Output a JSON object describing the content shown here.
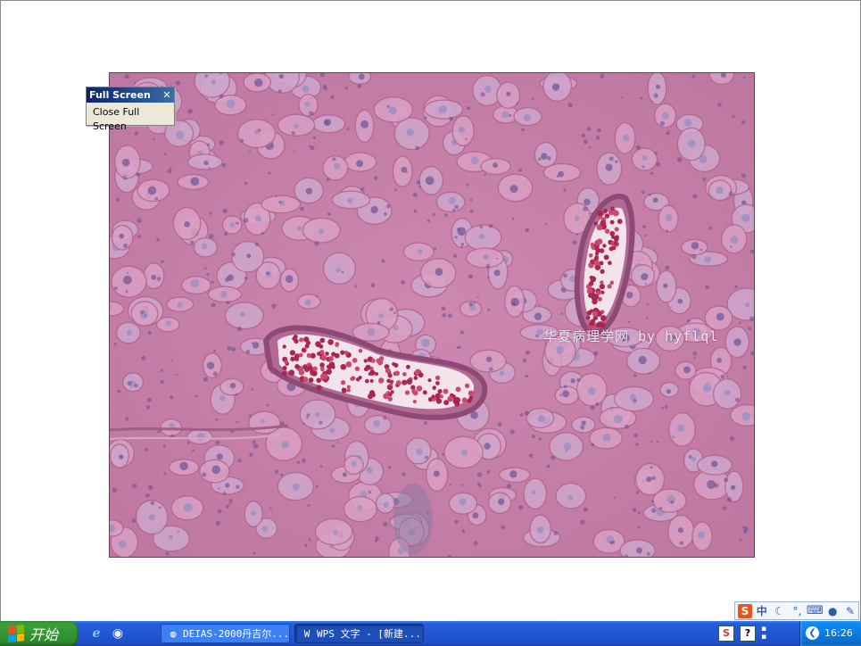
{
  "viewer": {
    "watermark": "华夏病理学网 by hyflql"
  },
  "fullscreen_toolbar": {
    "title": "Full Screen",
    "close_glyph": "✕",
    "close_button_label": "Close Full Screen"
  },
  "ime_bar": {
    "logo": "S",
    "mode": "中",
    "icons": [
      "sogou-logo-icon",
      "chinese-mode-icon",
      "half-width-moon-icon",
      "punctuation-icon",
      "soft-keyboard-icon",
      "user-icon",
      "settings-wrench-icon"
    ]
  },
  "taskbar": {
    "start_label": "开始",
    "tasks": [
      {
        "label": "DEIAS-2000丹吉尔...",
        "icon": "app-globe-icon",
        "active": false
      },
      {
        "label": "WPS 文字 - [新建...",
        "icon": "wps-writer-icon",
        "active": true
      }
    ],
    "tray": {
      "clock": "16:26"
    }
  },
  "colors": {
    "taskbar_blue": "#245edb",
    "start_green": "#36a036",
    "tissue_pink": "#c77fa8",
    "toolbar_title": "#0a246a"
  }
}
